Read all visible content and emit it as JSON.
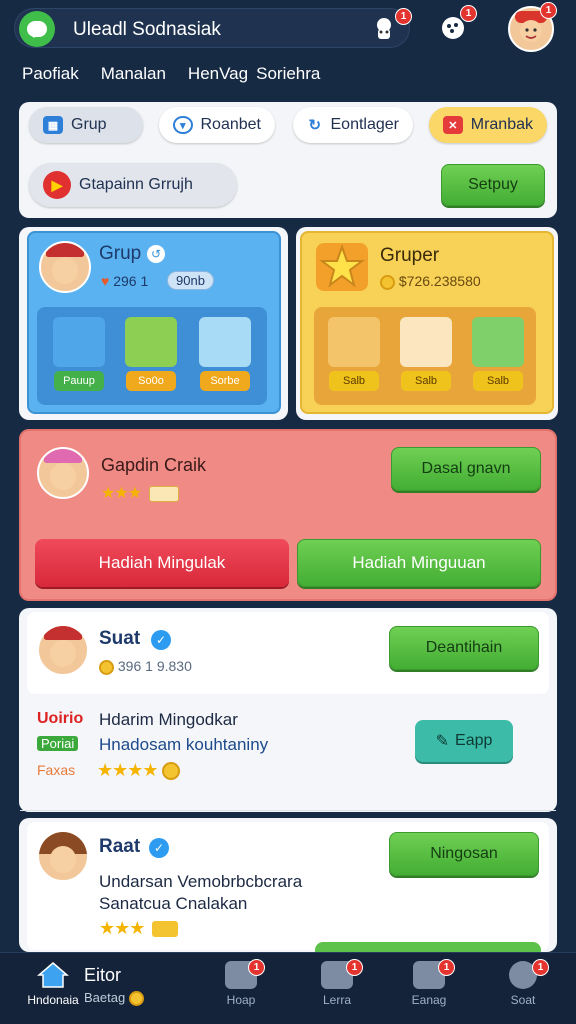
{
  "header": {
    "title": "Uleadl Sodnasiak",
    "badges": [
      "1",
      "1",
      "1"
    ]
  },
  "tabs": [
    "Paofiak",
    "Manalan",
    "HenVag",
    "Soriehra"
  ],
  "filters": {
    "chips": [
      {
        "label": "Grup",
        "icon": "grid-icon"
      },
      {
        "label": "Roanbet",
        "icon": "shield-icon"
      },
      {
        "label": "Eontlager",
        "icon": "refresh-icon"
      },
      {
        "label": "Mranbak",
        "icon": "flag-icon"
      }
    ],
    "secondary_chip": "Gtapainn Grrujh",
    "action": "Setpuy"
  },
  "group_card": {
    "title": "Grup",
    "count": "296 1",
    "tag": "90nb",
    "tiles": [
      "Pauup",
      "So0o",
      "Sorbe"
    ]
  },
  "gruper_card": {
    "title": "Gruper",
    "amount": "$726.238580",
    "tiles": [
      "Salb",
      "Salb",
      "Salb"
    ]
  },
  "promo_card": {
    "title": "Gapdin Craik",
    "action": "Dasal gnavn",
    "button_left": "Hadiah Mingulak",
    "button_right": "Hadiah Minguuan"
  },
  "feed": [
    {
      "name": "Suat",
      "coins": "396 1 9.830",
      "action": "Deantihain",
      "line1_label": "Uoirio",
      "line1_text": "Hdarim Mingodkar",
      "line2_label": "Poriai",
      "line2_text": "Hnadosam kouhtaniny",
      "line3_label": "Faxas",
      "small_action": "Eapp"
    },
    {
      "name": "Raat",
      "action": "Ningosan",
      "text1": "Undarsan Vemobrbcbcrara",
      "text2": "Sanatcua Cnalakan"
    }
  ],
  "navbar": {
    "items": [
      {
        "label": "Hndonaia",
        "icon": "home-icon"
      },
      {
        "label": "Eitor",
        "sub": "Baetag",
        "icon": "profile-icon"
      },
      {
        "label": "Hoap",
        "icon": "cart-icon"
      },
      {
        "label": "Lerra",
        "icon": "camera-icon"
      },
      {
        "label": "Eanag",
        "icon": "grid-icon"
      },
      {
        "label": "Soat",
        "icon": "settings-icon"
      }
    ]
  },
  "colors": {
    "background": "#172a44",
    "accent_green": "#4caf3a",
    "accent_red": "#e0303f",
    "blue_card": "#5ab2f0",
    "yellow_card": "#f7d257",
    "pink_card": "#ef8a84"
  }
}
